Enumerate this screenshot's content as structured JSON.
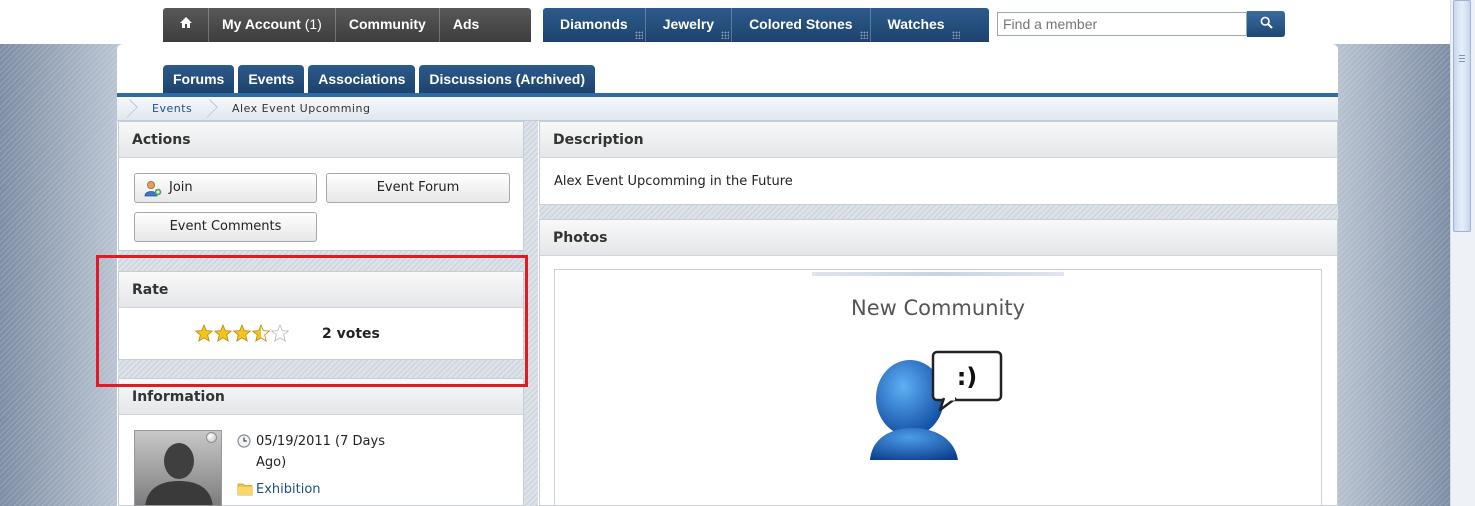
{
  "topnav": {
    "home_icon": "home-icon",
    "my_account_label": "My Account",
    "my_account_count": "(1)",
    "community_label": "Community",
    "ads_label": "Ads",
    "diamonds_label": "Diamonds",
    "jewelry_label": "Jewelry",
    "colored_stones_label": "Colored Stones",
    "watches_label": "Watches",
    "search_placeholder": "Find a member",
    "search_icon": "search-icon"
  },
  "subtabs": [
    "Forums",
    "Events",
    "Associations",
    "Discussions (Archived)"
  ],
  "breadcrumb": {
    "link": "Events",
    "current": "Alex Event Upcomming"
  },
  "actions": {
    "header": "Actions",
    "join_label": "Join",
    "event_forum_label": "Event Forum",
    "event_comments_label": "Event Comments"
  },
  "rate": {
    "header": "Rate",
    "rating": 3.5,
    "max": 5,
    "votes_label": "2 votes"
  },
  "information": {
    "header": "Information",
    "date_line1": "05/19/2011 (7 Days",
    "date_line2": "Ago)",
    "category": "Exhibition"
  },
  "description": {
    "header": "Description",
    "text": "Alex Event Upcomming in the Future"
  },
  "photos": {
    "header": "Photos",
    "title": "New Community",
    "bubble_text": ":)"
  },
  "colors": {
    "nav_dark": "#3d3d3d",
    "nav_blue": "#1d436d",
    "accent_rule": "#2d6ba8",
    "highlight": "#e01b24",
    "link": "#1d4f8a"
  }
}
